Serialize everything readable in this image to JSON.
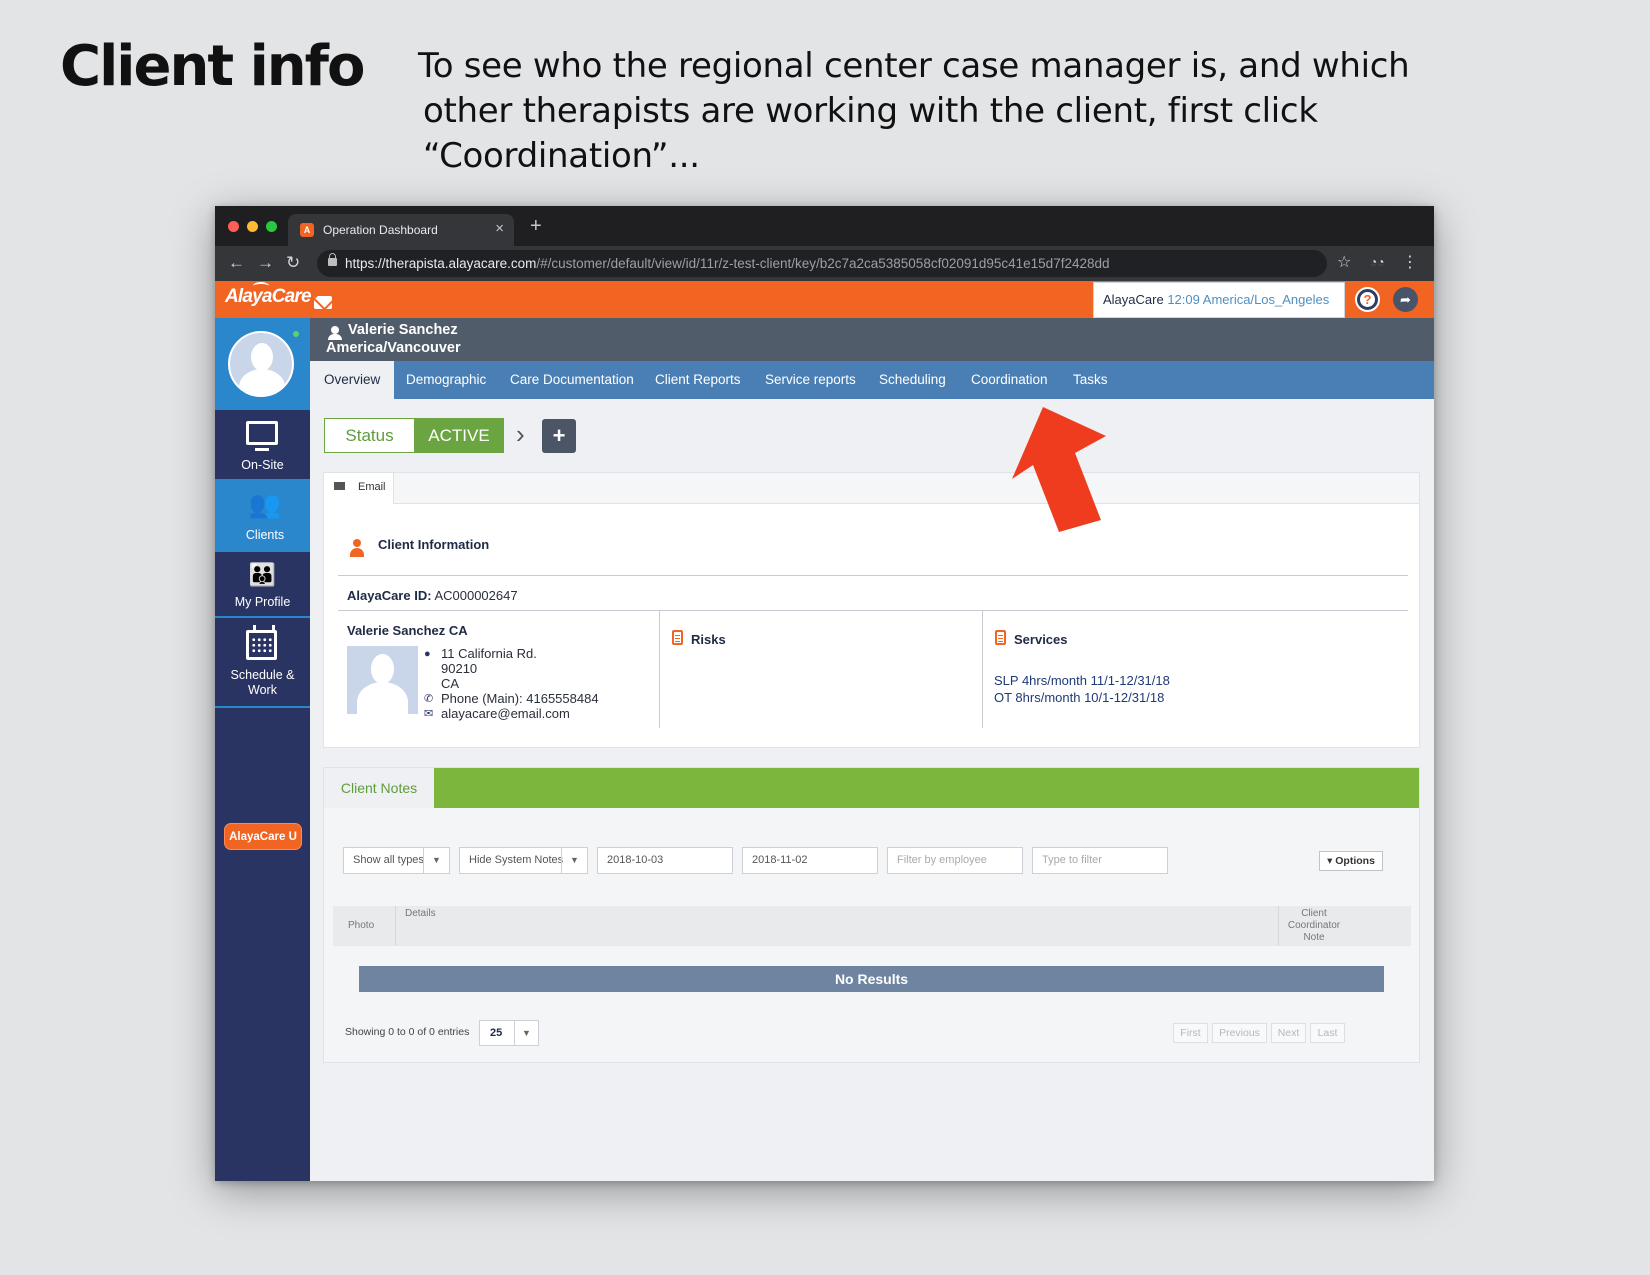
{
  "slide": {
    "title": "Client info",
    "caption_line1": "To see who the regional center case manager is, and which",
    "caption_line2": "other therapists are working with the client, first click “Coordination”..."
  },
  "browser": {
    "tab_title": "Operation Dashboard",
    "tab_close": "×",
    "new_tab": "+",
    "url_main": "https://therapista.alayacare.com",
    "url_rest": "/#/customer/default/view/id/11r/z-test-client/key/b2c7a2ca5385058cf02091d95c41e15d7f2428dd",
    "back": "←",
    "forward": "→",
    "reload": "↻",
    "star": "☆",
    "menu": "⋮"
  },
  "appbar": {
    "logo": "AlayaCare",
    "clock_brand": "AlayaCare",
    "clock_time": "12:09",
    "clock_tz": "America/Los_Angeles",
    "help": "?",
    "share": "➦"
  },
  "sidebar": {
    "items": [
      {
        "label": "On-Site",
        "icon": "monitor-icon"
      },
      {
        "label": "Clients",
        "icon": "clients-icon"
      },
      {
        "label": "My Profile",
        "icon": "profile-icon"
      },
      {
        "label": "Schedule &",
        "label2": "Work",
        "icon": "calendar-icon"
      }
    ],
    "alayacare_u": "AlayaCare U"
  },
  "client": {
    "name": "Valerie Sanchez",
    "timezone": "America/Vancouver"
  },
  "tabs": [
    "Overview",
    "Demographic",
    "Care Documentation",
    "Client Reports",
    "Service reports",
    "Scheduling",
    "Coordination",
    "Tasks"
  ],
  "status": {
    "label": "Status",
    "value": "ACTIVE",
    "chevron": "›",
    "plus": "+"
  },
  "info": {
    "email_tab": "Email",
    "title": "Client Information",
    "id_label": "AlayaCare ID:",
    "id_value": "AC000002647",
    "addr_name": "Valerie Sanchez CA",
    "street": "11 California Rd.",
    "zip": "90210",
    "state": "CA",
    "phone": "Phone (Main): 4165558484",
    "email": "alayacare@email.com",
    "risks_title": "Risks",
    "services_title": "Services",
    "service_1": "SLP 4hrs/month 11/1-12/31/18",
    "service_2": "OT 8hrs/month 10/1-12/31/18"
  },
  "notes": {
    "tab": "Client Notes",
    "filter_types": "Show all types",
    "filter_system": "Hide System Notes",
    "date_from": "2018-10-03",
    "date_to": "2018-11-02",
    "employee_placeholder": "Filter by employee",
    "filter_placeholder": "Type to filter",
    "options": "▾ Options",
    "col_photo": "Photo",
    "col_details": "Details",
    "col_coord_1": "Client",
    "col_coord_2": "Coordinator",
    "col_coord_3": "Note",
    "no_results": "No Results",
    "showing": "Showing 0 to 0 of 0 entries",
    "page_size": "25",
    "first": "First",
    "previous": "Previous",
    "next": "Next",
    "last": "Last"
  },
  "colors": {
    "brand_orange": "#f26422",
    "nav_blue": "#4a7fb5",
    "sidebar_navy": "#2a3462",
    "status_green": "#6aa542",
    "annotation_red": "#f03c1e"
  }
}
